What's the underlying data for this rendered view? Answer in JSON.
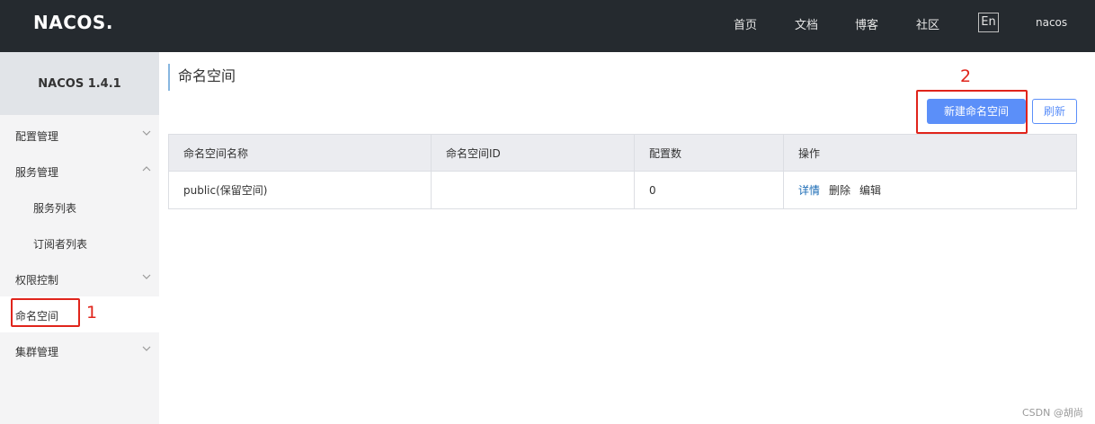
{
  "header": {
    "logo_text": "NACOS",
    "logo_dot": ".",
    "nav": [
      "首页",
      "文档",
      "博客",
      "社区"
    ],
    "lang": "En",
    "user": "nacos"
  },
  "sidebar": {
    "version": "NACOS 1.4.1",
    "items": [
      {
        "label": "配置管理",
        "chevron": "down"
      },
      {
        "label": "服务管理",
        "chevron": "up"
      },
      {
        "label": "服务列表"
      },
      {
        "label": "订阅者列表"
      },
      {
        "label": "权限控制",
        "chevron": "down"
      },
      {
        "label": "命名空间",
        "active": true
      },
      {
        "label": "集群管理",
        "chevron": "down"
      }
    ]
  },
  "annotations": {
    "one": "1",
    "two": "2",
    "color": "#e0241b"
  },
  "main": {
    "title": "命名空间",
    "create_button": "新建命名空间",
    "refresh_button": "刷新",
    "table": {
      "headers": [
        "命名空间名称",
        "命名空间ID",
        "配置数",
        "操作"
      ],
      "rows": [
        {
          "name": "public(保留空间)",
          "id": "",
          "count": "0",
          "ops": [
            "详情",
            "删除",
            "编辑"
          ]
        }
      ]
    }
  },
  "watermark": "CSDN @胡尚",
  "colors": {
    "header_bg": "#252a2f",
    "primary": "#5b8ff9",
    "sidebar_bg": "#f4f4f5"
  }
}
